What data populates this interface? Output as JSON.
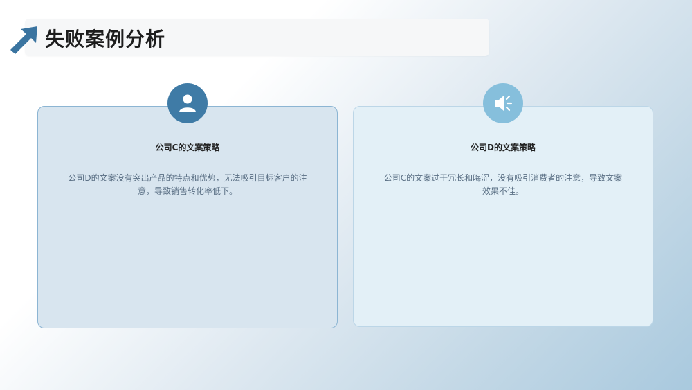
{
  "header": {
    "title": "失败案例分析",
    "icon": "arrow-up-left-icon"
  },
  "cards": [
    {
      "icon": "user-icon",
      "title": "公司C的文案策略",
      "body": "公司D的文案没有突出产品的特点和优势，无法吸引目标客户的注意，导致销售转化率低下。"
    },
    {
      "icon": "speaker-icon",
      "title": "公司D的文案策略",
      "body": "公司C的文案过于冗长和晦涩，没有吸引消费者的注意，导致文案效果不佳。"
    }
  ],
  "colors": {
    "accent_dark": "#3f7ba6",
    "accent_light": "#86bfdc",
    "title_text": "#1d1d1d",
    "body_text": "#5a6f84"
  }
}
